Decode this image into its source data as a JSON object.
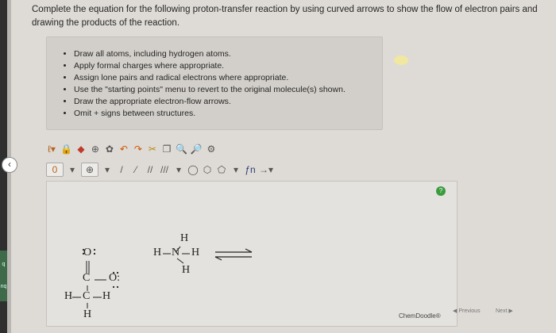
{
  "question": {
    "text": "Complete the equation for the following proton-transfer reaction by using curved arrows to show the flow of electron pairs and drawing the products of the reaction."
  },
  "instructions": [
    "Draw all atoms, including hydrogen atoms.",
    "Apply formal charges where appropriate.",
    "Assign lone pairs and radical electrons where appropriate.",
    "Use the \"starting points\" menu to revert to the original molecule(s) shown.",
    "Draw the appropriate electron-flow arrows.",
    "Omit + signs between structures."
  ],
  "toolbar": {
    "charge_minus": "0",
    "charge_plus": "⊕",
    "fn_label": "ƒn"
  },
  "molecule": {
    "o_top": "O",
    "c_mid": "C",
    "o_right": "O:",
    "h_left": "H",
    "c_lower": "C",
    "h_right": "H",
    "h_bottom": "H",
    "nh3_h_top": "H",
    "nh3_h_left": "H",
    "nh3_n": "N",
    "nh3_h_right": "H",
    "nh3_h_bottom": "H"
  },
  "footer": {
    "brand": "ChemDoodle®",
    "previous": "Previous",
    "next": "Next"
  },
  "left_tabs": [
    "q",
    "nq"
  ],
  "help_label": "?"
}
